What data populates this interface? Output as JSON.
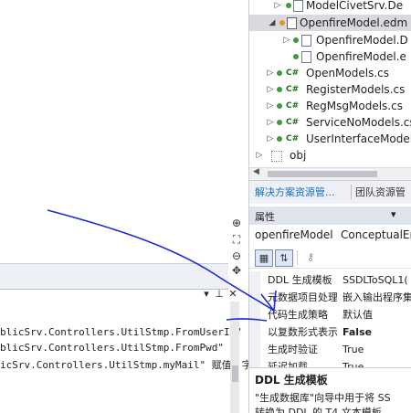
{
  "output": {
    "lines": [
      "blicSrv.Controllers.UtilStmp.FromUserId\"",
      "blicSrv.Controllers.UtilStmp.FromPwd\"",
      "icSrv.Controllers.UtilStmp.myMail\" 赋值，字"
    ],
    "dropdown_icon": "dropdown-arrow-icon",
    "pin_icon": "pin-icon",
    "close_icon": "close-icon"
  },
  "solution_explorer": {
    "items": [
      {
        "label": "ModelCivetSrv.De",
        "icon": "file-icon"
      },
      {
        "label": "OpenfireModel.edm",
        "icon": "edmx-icon"
      },
      {
        "label": "OpenfireModel.D",
        "icon": "file-icon"
      },
      {
        "label": "OpenfireModel.e",
        "icon": "file-icon"
      },
      {
        "label": "OpenModels.cs",
        "icon": "csharp-file-icon"
      },
      {
        "label": "RegisterModels.cs",
        "icon": "csharp-file-icon"
      },
      {
        "label": "RegMsgModels.cs",
        "icon": "csharp-file-icon"
      },
      {
        "label": "ServiceNoModels.cs",
        "icon": "csharp-file-icon"
      },
      {
        "label": "UserInterfaceModels",
        "icon": "csharp-file-icon"
      },
      {
        "label": "obj",
        "icon": "folder-icon"
      }
    ],
    "cs_badge": "C#",
    "hscroll_left": "◀",
    "hscroll_right": "▶"
  },
  "tabs": {
    "solution_explorer": "解决方案资源管...",
    "team_explorer": "团队资源管"
  },
  "properties": {
    "header": "属性",
    "object_name": "openfireModel",
    "object_type": "ConceptualEr",
    "rows": [
      {
        "name": "DDL 生成模板",
        "value": "SSDLToSQL1("
      },
      {
        "name": "元数据项目处理",
        "value": "嵌入输出程序集"
      },
      {
        "name": "代码生成策略",
        "value": "默认值"
      },
      {
        "name": "以复数形式表示",
        "value": "False"
      },
      {
        "name": "生成时验证",
        "value": "True"
      },
      {
        "name": "延迟加载",
        "value": "True"
      }
    ],
    "description_title": "DDL 生成模板",
    "description_text": "\"生成数据库\"向导中用于将 SS",
    "description_text2": "转换为 DDL 的 T4 文本模板。"
  },
  "colors": {
    "accent": "#0e70c0",
    "annotation": "#1a2bd6",
    "selected": "#d9d9de"
  }
}
